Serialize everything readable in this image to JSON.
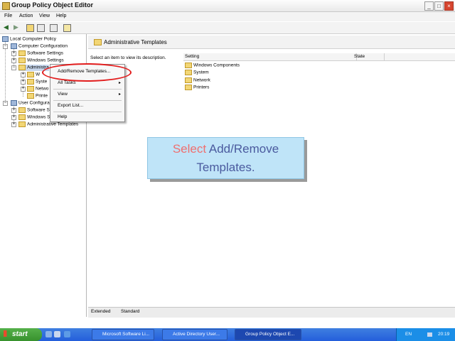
{
  "window": {
    "title": "Group Policy Object Editor",
    "controls": [
      "minimize",
      "maximize",
      "close"
    ]
  },
  "menu": {
    "items": [
      "File",
      "Action",
      "View",
      "Help"
    ]
  },
  "tree": {
    "root": "Local Computer Policy",
    "computer_config": "Computer Configuration",
    "software_settings": "Software Settings",
    "windows_settings": "Windows Settings",
    "admin_templates_partial": "Administra",
    "child_w": "W",
    "child_system_partial": "Syste",
    "child_network_partial": "Netwo",
    "child_printers_partial": "Printe",
    "user_config_partial": "User Configura",
    "user_software_partial": "Software S",
    "user_windows_partial": "Windows S",
    "user_admin_templates": "Administrative Templates"
  },
  "context_menu": {
    "add_remove": "Add/Remove Templates...",
    "all_tasks": "All Tasks",
    "view": "View",
    "export": "Export List...",
    "help": "Help"
  },
  "right": {
    "header_title": "Administrative Templates",
    "description": "Select an item to view its description.",
    "col_setting": "Setting",
    "col_state": "State",
    "items": [
      "Windows Components",
      "System",
      "Network",
      "Printers"
    ]
  },
  "tabs": {
    "extended": "Extended",
    "standard": "Standard"
  },
  "callout": {
    "word_highlight": "Select",
    "rest_line1": " Add/Remove",
    "line2": "Templates."
  },
  "taskbar": {
    "start": "start",
    "tasks": [
      "Microsoft Software Li...",
      "Active Directory User...",
      "Group Policy Object E..."
    ],
    "language": "EN",
    "clock": "20:19"
  }
}
